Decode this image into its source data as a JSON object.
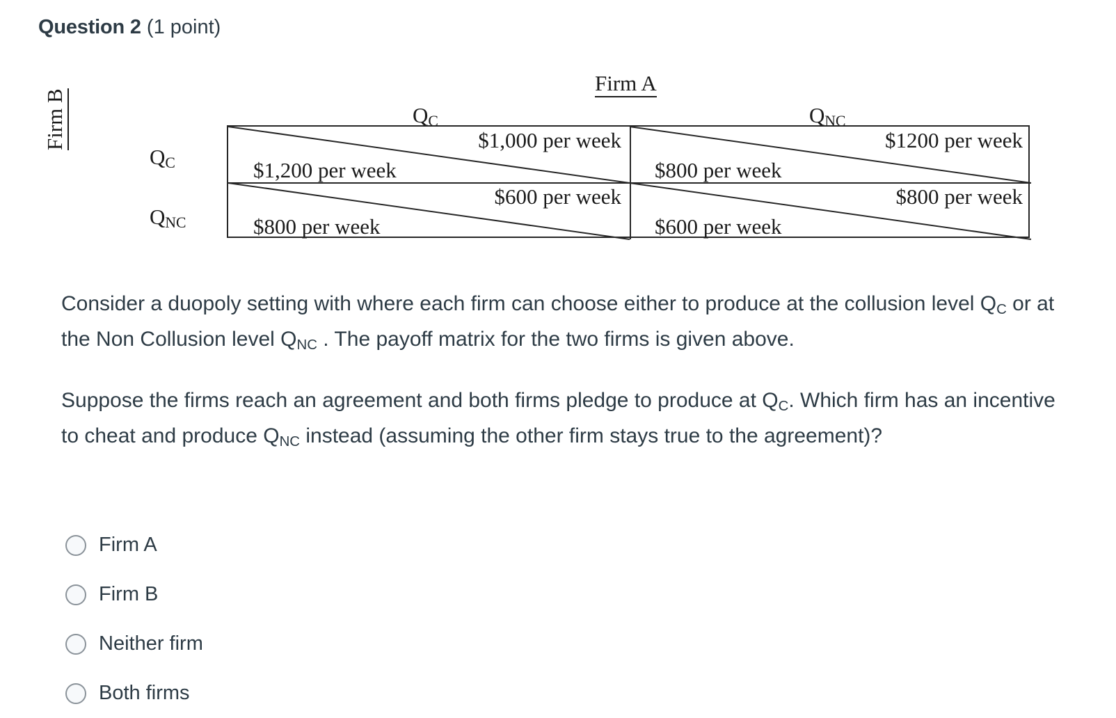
{
  "question": {
    "title": "Question 2",
    "points": "(1 point)"
  },
  "matrix": {
    "col_group_label": "Firm A",
    "row_group_label": "Firm B",
    "col_headers": [
      {
        "base": "Q",
        "sub": "C"
      },
      {
        "base": "Q",
        "sub": "NC"
      }
    ],
    "row_headers": [
      {
        "base": "Q",
        "sub": "C"
      },
      {
        "base": "Q",
        "sub": "NC"
      }
    ],
    "cells": [
      [
        {
          "firm_a_payoff": "$1,000 per week",
          "firm_b_payoff": "$1,200 per week"
        },
        {
          "firm_a_payoff": "$1200 per week",
          "firm_b_payoff": "$800 per week"
        }
      ],
      [
        {
          "firm_a_payoff": "$600 per week",
          "firm_b_payoff": "$800 per week"
        },
        {
          "firm_a_payoff": "$800 per week",
          "firm_b_payoff": "$600 per week"
        }
      ]
    ]
  },
  "prompt": {
    "paragraph_1": {
      "part_a": "Consider a duopoly setting with where each firm can choose either to produce at the collusion level Q",
      "sub_1": "C",
      "part_b": " or at the Non Collusion level Q",
      "sub_2": "NC",
      "part_c": " . The payoff matrix for the two firms is given above."
    },
    "paragraph_2": {
      "part_a": "Suppose the firms reach an agreement and both firms pledge to produce at Q",
      "sub_1": "C",
      "part_b": ". Which firm has an incentive to cheat and produce Q",
      "sub_2": "NC",
      "part_c": " instead (assuming the other firm stays true to the agreement)?"
    }
  },
  "answers": [
    {
      "label": "Firm A",
      "selected": false
    },
    {
      "label": "Firm B",
      "selected": false
    },
    {
      "label": "Neither firm",
      "selected": false
    },
    {
      "label": "Both firms",
      "selected": false
    }
  ],
  "colors": {
    "text": "#2d3b45",
    "ink": "#1a1a1a",
    "rule": "#262626",
    "radio_border": "#8a9299",
    "radio_fill": "#f7f9fb",
    "background": "#ffffff"
  }
}
